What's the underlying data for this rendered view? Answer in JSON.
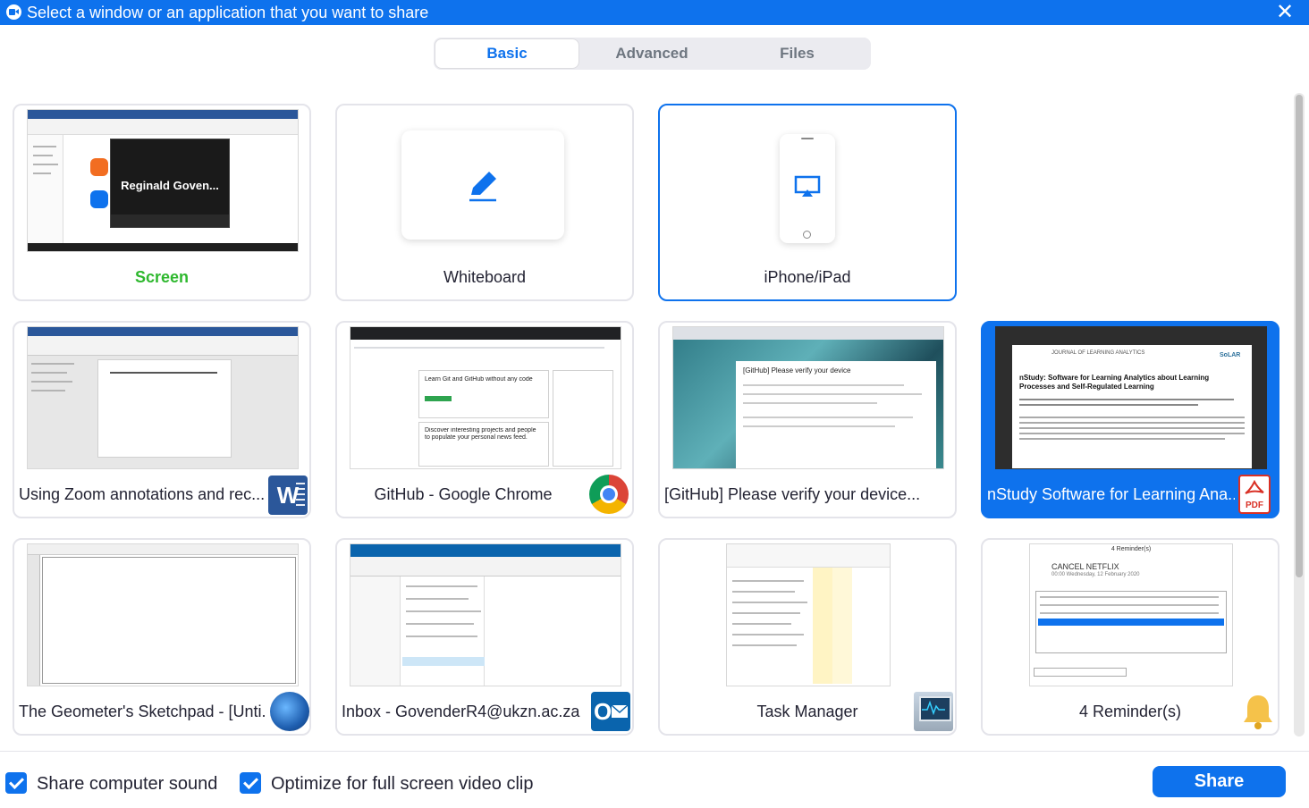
{
  "window": {
    "title": "Select a window or an application that you want to share",
    "close_glyph": "✕"
  },
  "tabs": [
    {
      "label": "Basic",
      "active": true
    },
    {
      "label": "Advanced",
      "active": false
    },
    {
      "label": "Files",
      "active": false
    }
  ],
  "tiles": [
    {
      "label": "Screen",
      "thumb_text": "Reginald Goven...",
      "state": "normal"
    },
    {
      "label": "Whiteboard",
      "icon": "pen-icon",
      "state": "normal"
    },
    {
      "label": "iPhone/iPad",
      "icon": "airplay-icon",
      "state": "outlined"
    },
    {
      "label": "Using Zoom annotations and rec...",
      "icon": "word-icon",
      "icon_letter": "W",
      "state": "normal"
    },
    {
      "label": "GitHub - Google Chrome",
      "icon": "chrome-icon",
      "thumb_text_1": "Learn Git and GitHub without any code",
      "thumb_text_2": "Discover interesting projects and people to populate your personal news feed.",
      "state": "normal"
    },
    {
      "label": "[GitHub] Please verify your device...",
      "icon": "gmail-icon",
      "thumb_text": "[GitHub] Please verify your device",
      "state": "normal"
    },
    {
      "label": "nStudy Software for Learning Ana...",
      "icon": "pdf-icon",
      "icon_text": "PDF",
      "thumb_text_1": "JOURNAL OF LEARNING ANALYTICS",
      "thumb_text_2": "nStudy: Software for Learning Analytics about Learning Processes and Self-Regulated Learning",
      "thumb_text_3": "SoLAR",
      "state": "selected"
    },
    {
      "label": "The Geometer's Sketchpad - [Unti...",
      "icon": "globe-icon",
      "state": "normal"
    },
    {
      "label": "Inbox - GovenderR4@ukzn.ac.za ...",
      "icon": "outlook-icon",
      "icon_letter": "O",
      "state": "normal"
    },
    {
      "label": "Task Manager",
      "icon": "task-manager-icon",
      "state": "normal"
    },
    {
      "label": "4 Reminder(s)",
      "icon": "bell-icon",
      "thumb_text_1": "4 Reminder(s)",
      "thumb_text_2": "CANCEL NETFLIX",
      "thumb_text_3": "00:00 Wednesday, 12 February 2020",
      "state": "normal"
    }
  ],
  "options": [
    {
      "label": "Share computer sound",
      "checked": true
    },
    {
      "label": "Optimize for full screen video clip",
      "checked": true
    }
  ],
  "share_button": "Share",
  "colors": {
    "accent": "#0e72ed",
    "screen_label": "#2eb82e"
  }
}
